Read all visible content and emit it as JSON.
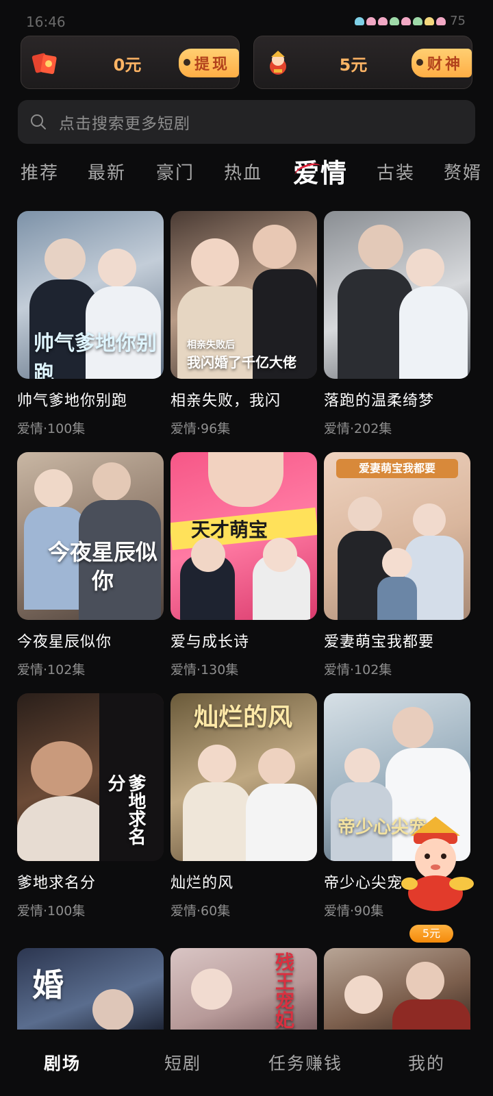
{
  "status": {
    "time": "16:46",
    "battery": "75"
  },
  "wallets": [
    {
      "amount": "0元",
      "action": "提现",
      "icon": "red-packet-icon"
    },
    {
      "amount": "5元",
      "action": "财神",
      "icon": "fortune-god-icon"
    }
  ],
  "search": {
    "placeholder": "点击搜索更多短剧"
  },
  "tabs": [
    "推荐",
    "最新",
    "豪门",
    "热血",
    "爱情",
    "古装",
    "赘婿"
  ],
  "active_tab": "爱情",
  "dramas": [
    {
      "title": "帅气爹地你别跑",
      "meta": "爱情·100集"
    },
    {
      "title": "相亲失败，我闪",
      "meta": "爱情·96集"
    },
    {
      "title": "落跑的温柔绮梦",
      "meta": "爱情·202集"
    },
    {
      "title": "今夜星辰似你",
      "meta": "爱情·102集"
    },
    {
      "title": "爱与成长诗",
      "meta": "爱情·130集"
    },
    {
      "title": "爱妻萌宝我都要",
      "meta": "爱情·102集"
    },
    {
      "title": "爹地求名分",
      "meta": "爱情·100集"
    },
    {
      "title": "灿烂的风",
      "meta": "爱情·60集"
    },
    {
      "title": "帝少心尖宠",
      "meta": "爱情·90集"
    },
    {
      "title": "",
      "meta": ""
    },
    {
      "title": "",
      "meta": ""
    },
    {
      "title": "",
      "meta": ""
    }
  ],
  "poster_text": {
    "p1": "帅气爹地你别跑",
    "p2a": "相亲失败后",
    "p2b": "我闪婚了千亿大佬",
    "p4": "今夜星辰似你",
    "p5": "天才萌宝",
    "p6": "爱妻萌宝我都要",
    "p7": "爹地求名分",
    "p8": "灿烂的风",
    "p9": "帝少心尖宠",
    "p10": "婚",
    "p11": "残王宠妃"
  },
  "fab_badge": "5元",
  "nav": [
    "剧场",
    "短剧",
    "任务赚钱",
    "我的"
  ],
  "nav_active": "剧场",
  "colors": {
    "accent": "#ffb565",
    "tag_bg": "#ffbd5a",
    "tag_text": "#b2421c",
    "active_underline": "#e0233a"
  }
}
